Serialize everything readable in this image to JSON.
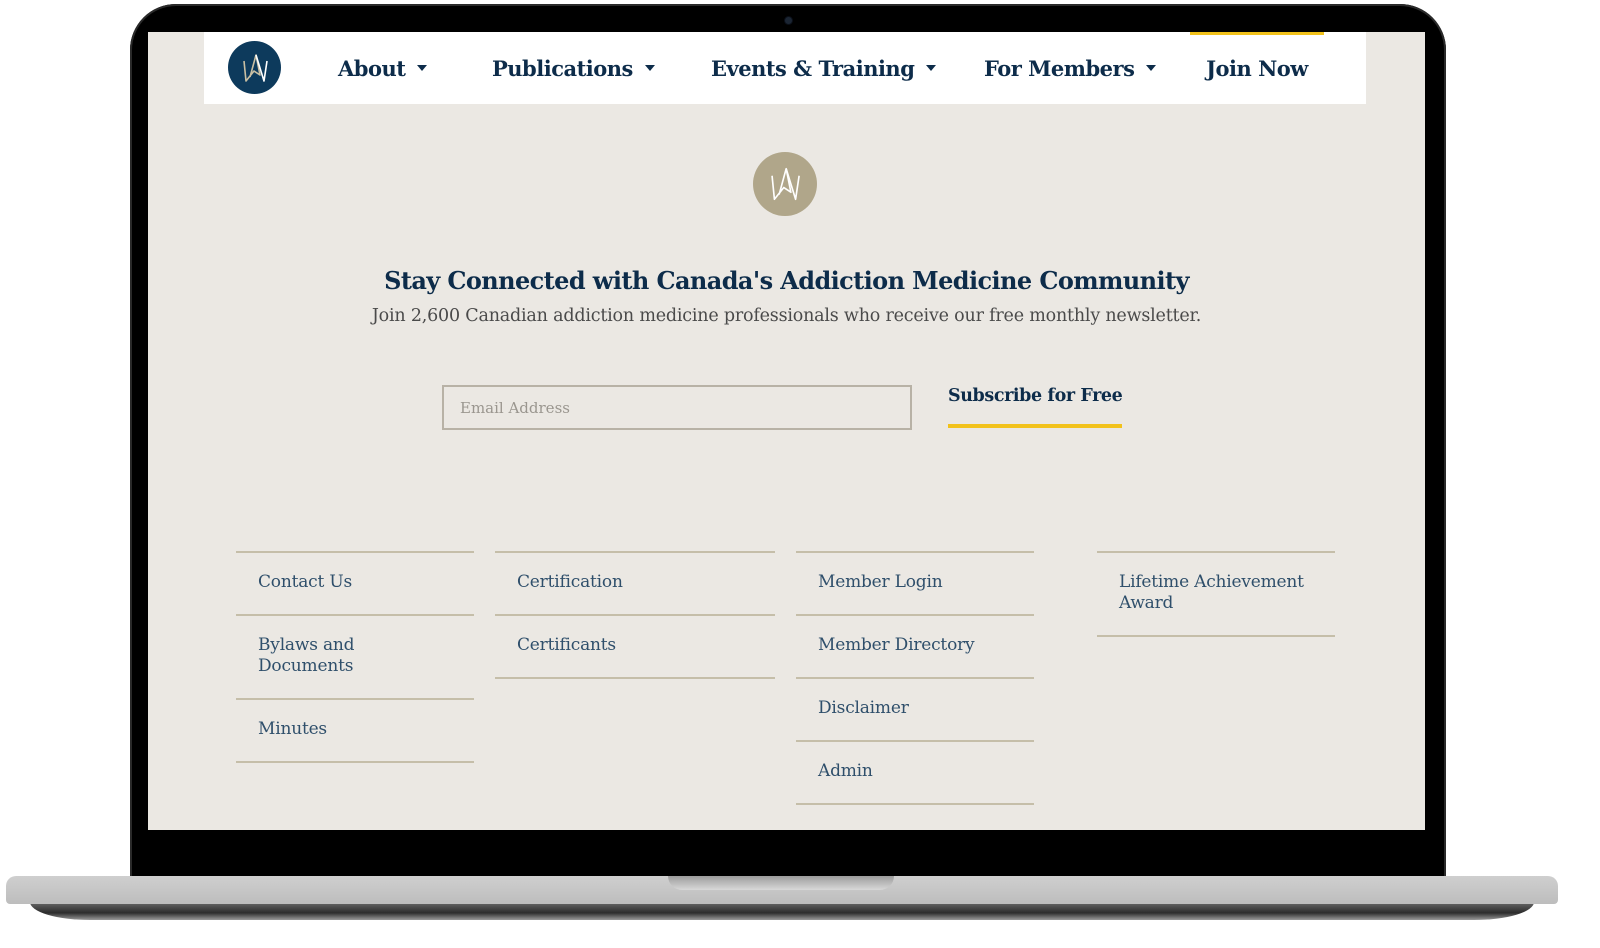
{
  "nav": {
    "logo_icon": "amc-monogram-icon",
    "items": [
      {
        "label": "About",
        "has_dropdown": true
      },
      {
        "label": "Publications",
        "has_dropdown": true
      },
      {
        "label": "Events & Training",
        "has_dropdown": true
      },
      {
        "label": "For Members",
        "has_dropdown": true
      }
    ],
    "cta": {
      "label": "Join Now"
    }
  },
  "newsletter": {
    "badge_icon": "amc-monogram-icon",
    "headline": "Stay Connected with Canada's Addiction Medicine Community",
    "subline": "Join 2,600 Canadian addiction medicine professionals who receive our free monthly newsletter.",
    "email_placeholder": "Email Address",
    "email_value": "",
    "subscribe_label": "Subscribe for Free"
  },
  "footer": {
    "columns": [
      {
        "links": [
          "Contact Us",
          "Bylaws and Documents",
          "Minutes"
        ]
      },
      {
        "links": [
          "Certification",
          "Certificants"
        ]
      },
      {
        "links": [
          "Member Login",
          "Member Directory",
          "Disclaimer",
          "Admin"
        ]
      },
      {
        "links": [
          "Lifetime Achievement Award"
        ]
      }
    ]
  },
  "colors": {
    "brand_navy": "#0d3a5c",
    "text_navy": "#0d2c4a",
    "accent_yellow": "#f2c21b",
    "badge_taupe": "#b0a68a",
    "page_bg": "#ebe8e3",
    "divider": "#c5bea9"
  }
}
